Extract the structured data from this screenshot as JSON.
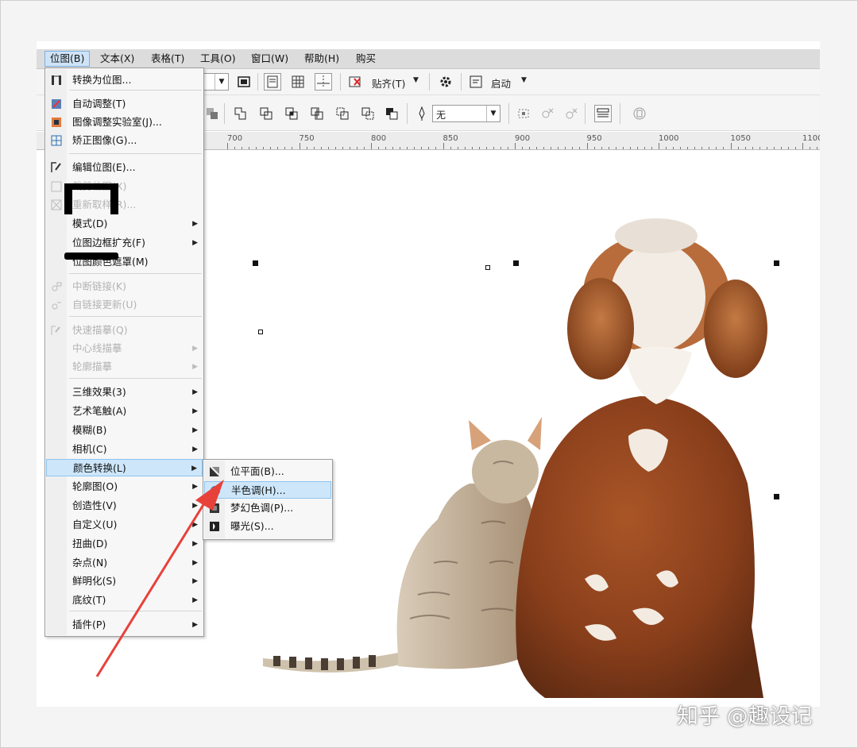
{
  "menubar": {
    "items": [
      "位图(B)",
      "文本(X)",
      "表格(T)",
      "工具(O)",
      "窗口(W)",
      "帮助(H)",
      "购买"
    ]
  },
  "toolbar": {
    "snap_label": "贴齐(T)",
    "launch_label": "启动",
    "outline_value": "无"
  },
  "ruler": {
    "labels": [
      "700",
      "750",
      "800",
      "850",
      "900",
      "950",
      "1000",
      "1050",
      "1100"
    ]
  },
  "bitmap_menu": {
    "items": [
      {
        "label": "转换为位图...",
        "enabled": true
      },
      {
        "label": "自动调整(T)",
        "enabled": true
      },
      {
        "label": "图像调整实验室(J)...",
        "enabled": true
      },
      {
        "label": "矫正图像(G)...",
        "enabled": true
      },
      {
        "label": "编辑位图(E)...",
        "enabled": true
      },
      {
        "label": "裁剪位图(X)",
        "enabled": false
      },
      {
        "label": "重新取样(R)...",
        "enabled": false
      },
      {
        "label": "模式(D)",
        "enabled": true
      },
      {
        "label": "位图边框扩充(F)",
        "enabled": true
      },
      {
        "label": "位图颜色遮罩(M)",
        "enabled": true
      },
      {
        "label": "中断链接(K)",
        "enabled": false
      },
      {
        "label": "自链接更新(U)",
        "enabled": false
      },
      {
        "label": "快速描摹(Q)",
        "enabled": false
      },
      {
        "label": "中心线描摹",
        "enabled": false
      },
      {
        "label": "轮廓描摹",
        "enabled": false
      },
      {
        "label": "三维效果(3)",
        "enabled": true
      },
      {
        "label": "艺术笔触(A)",
        "enabled": true
      },
      {
        "label": "模糊(B)",
        "enabled": true
      },
      {
        "label": "相机(C)",
        "enabled": true
      },
      {
        "label": "颜色转换(L)",
        "enabled": true,
        "highlighted": true
      },
      {
        "label": "轮廓图(O)",
        "enabled": true
      },
      {
        "label": "创造性(V)",
        "enabled": true
      },
      {
        "label": "自定义(U)",
        "enabled": true
      },
      {
        "label": "扭曲(D)",
        "enabled": true
      },
      {
        "label": "杂点(N)",
        "enabled": true
      },
      {
        "label": "鲜明化(S)",
        "enabled": true
      },
      {
        "label": "底纹(T)",
        "enabled": true
      },
      {
        "label": "插件(P)",
        "enabled": true
      }
    ]
  },
  "color_transform_submenu": {
    "items": [
      {
        "label": "位平面(B)..."
      },
      {
        "label": "半色调(H)...",
        "highlighted": true
      },
      {
        "label": "梦幻色调(P)..."
      },
      {
        "label": "曝光(S)..."
      }
    ]
  },
  "watermark": "知乎 @趣设记",
  "colors": {
    "highlight": "#cde6fa",
    "annotation_arrow": "#e8413a",
    "dog_fur": "#9a4a22",
    "cat_fur": "#b9a58d"
  }
}
